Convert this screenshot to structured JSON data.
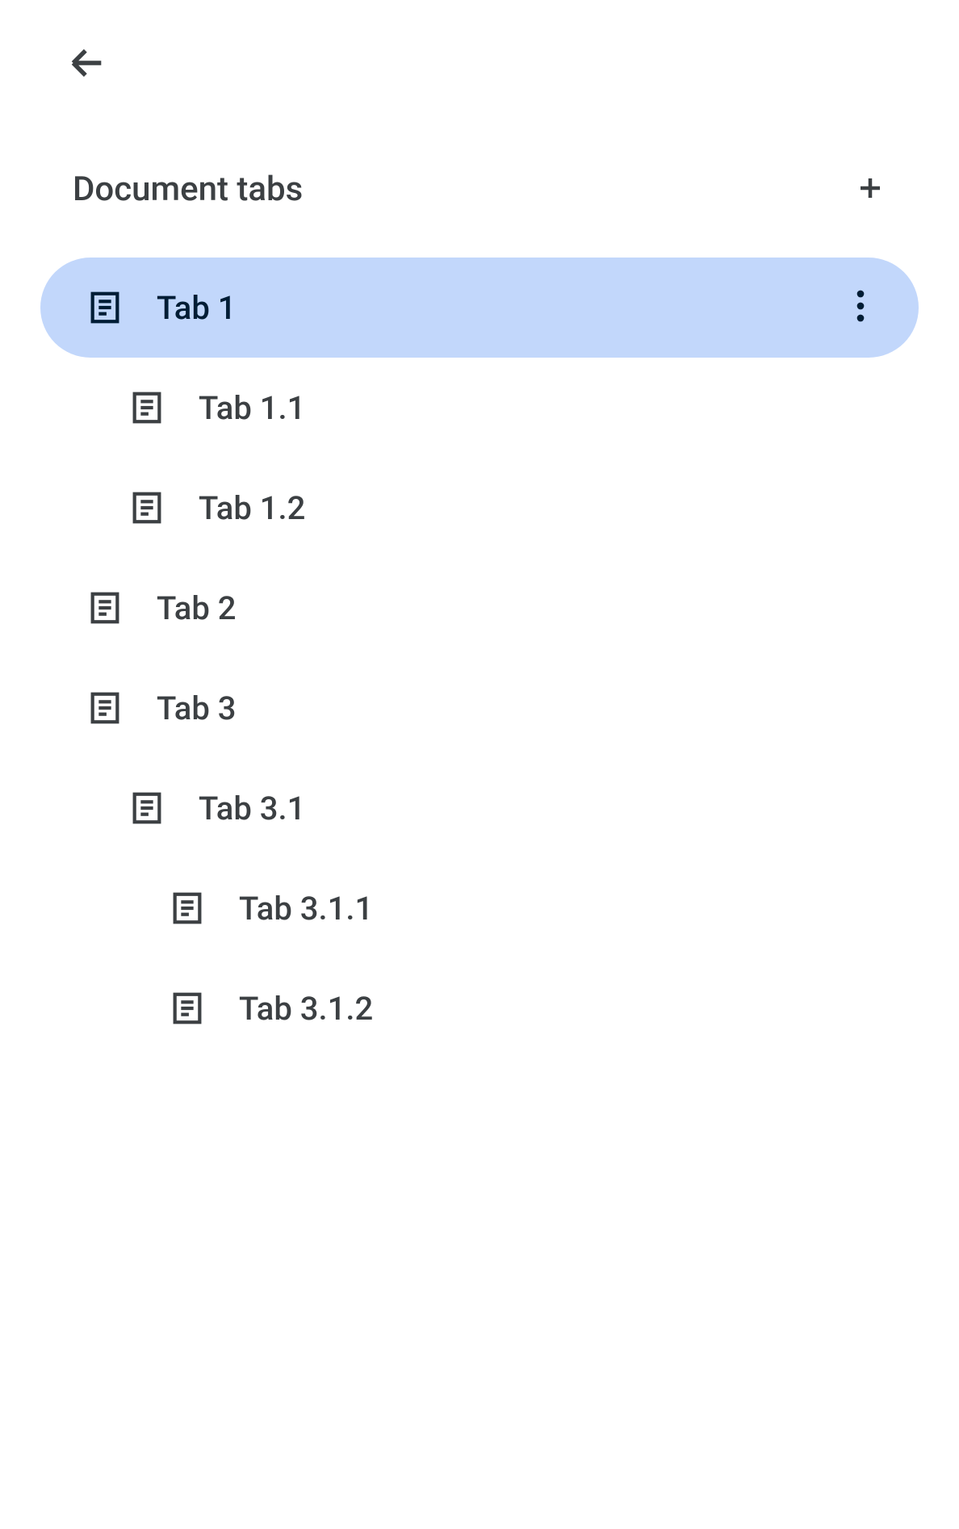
{
  "header": {
    "title": "Document tabs"
  },
  "tabs": [
    {
      "label": "Tab 1",
      "level": 0,
      "selected": true
    },
    {
      "label": "Tab 1.1",
      "level": 1,
      "selected": false
    },
    {
      "label": "Tab 1.2",
      "level": 1,
      "selected": false
    },
    {
      "label": "Tab 2",
      "level": 0,
      "selected": false
    },
    {
      "label": "Tab 3",
      "level": 0,
      "selected": false
    },
    {
      "label": "Tab 3.1",
      "level": 1,
      "selected": false
    },
    {
      "label": "Tab 3.1.1",
      "level": 2,
      "selected": false
    },
    {
      "label": "Tab 3.1.2",
      "level": 2,
      "selected": false
    }
  ],
  "colors": {
    "selected_bg": "#c2d7fb",
    "selected_fg": "#001d35",
    "text": "#3c4043"
  }
}
